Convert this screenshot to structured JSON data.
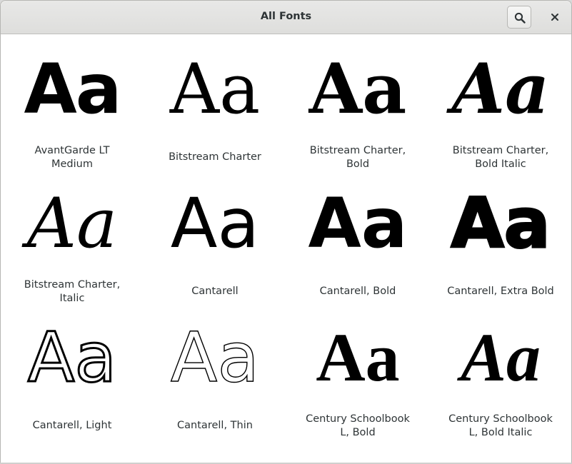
{
  "window": {
    "title": "All Fonts"
  },
  "header": {
    "search_icon": "search-icon",
    "close_icon": "close-icon"
  },
  "fonts": [
    {
      "sample": "Aa",
      "label": "AvantGarde LT Medium"
    },
    {
      "sample": "Aa",
      "label": "Bitstream Charter"
    },
    {
      "sample": "Aa",
      "label": "Bitstream Charter, Bold"
    },
    {
      "sample": "Aa",
      "label": "Bitstream Charter, Bold Italic"
    },
    {
      "sample": "Aa",
      "label": "Bitstream Charter, Italic"
    },
    {
      "sample": "Aa",
      "label": "Cantarell"
    },
    {
      "sample": "Aa",
      "label": "Cantarell, Bold"
    },
    {
      "sample": "Aa",
      "label": "Cantarell, Extra Bold"
    },
    {
      "sample": "Aa",
      "label": "Cantarell, Light"
    },
    {
      "sample": "Aa",
      "label": "Cantarell, Thin"
    },
    {
      "sample": "Aa",
      "label": "Century Schoolbook L, Bold"
    },
    {
      "sample": "Aa",
      "label": "Century Schoolbook L, Bold Italic"
    }
  ]
}
